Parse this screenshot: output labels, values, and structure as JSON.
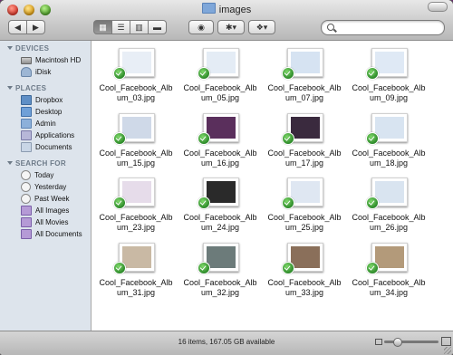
{
  "window": {
    "title": "images"
  },
  "toolbar": {
    "back_icon": "back-arrow-icon",
    "forward_icon": "forward-arrow-icon",
    "view_modes": [
      "icon-view",
      "list-view",
      "column-view",
      "coverflow-view"
    ],
    "quicklook_icon": "eye-icon",
    "action_icon": "gear-icon",
    "dropbox_icon": "dropbox-icon",
    "search_placeholder": ""
  },
  "sidebar": {
    "sections": [
      {
        "title": "DEVICES",
        "items": [
          {
            "label": "Macintosh HD",
            "icon": "harddrive-icon"
          },
          {
            "label": "iDisk",
            "icon": "idisk-icon"
          }
        ]
      },
      {
        "title": "PLACES",
        "items": [
          {
            "label": "Dropbox",
            "icon": "dropbox-icon"
          },
          {
            "label": "Desktop",
            "icon": "desktop-icon"
          },
          {
            "label": "Admin",
            "icon": "home-icon"
          },
          {
            "label": "Applications",
            "icon": "applications-icon"
          },
          {
            "label": "Documents",
            "icon": "documents-icon"
          }
        ]
      },
      {
        "title": "SEARCH FOR",
        "items": [
          {
            "label": "Today",
            "icon": "clock-icon"
          },
          {
            "label": "Yesterday",
            "icon": "clock-icon"
          },
          {
            "label": "Past Week",
            "icon": "clock-icon"
          },
          {
            "label": "All Images",
            "icon": "smart-folder-icon"
          },
          {
            "label": "All Movies",
            "icon": "smart-folder-icon"
          },
          {
            "label": "All Documents",
            "icon": "smart-folder-icon"
          }
        ]
      }
    ]
  },
  "files": [
    {
      "line1": "Cool_Facebook_Alb",
      "line2": "um_03.jpg",
      "tone": "#e8eef6"
    },
    {
      "line1": "Cool_Facebook_Alb",
      "line2": "um_05.jpg",
      "tone": "#e4ecf5"
    },
    {
      "line1": "Cool_Facebook_Alb",
      "line2": "um_07.jpg",
      "tone": "#d6e3f2"
    },
    {
      "line1": "Cool_Facebook_Alb",
      "line2": "um_09.jpg",
      "tone": "#dfe9f5"
    },
    {
      "line1": "Cool_Facebook_Alb",
      "line2": "um_15.jpg",
      "tone": "#cfd9e8"
    },
    {
      "line1": "Cool_Facebook_Alb",
      "line2": "um_16.jpg",
      "tone": "#5a2f5c"
    },
    {
      "line1": "Cool_Facebook_Alb",
      "line2": "um_17.jpg",
      "tone": "#3a2a3e"
    },
    {
      "line1": "Cool_Facebook_Alb",
      "line2": "um_18.jpg",
      "tone": "#d8e4f1"
    },
    {
      "line1": "Cool_Facebook_Alb",
      "line2": "um_23.jpg",
      "tone": "#e6dcea"
    },
    {
      "line1": "Cool_Facebook_Alb",
      "line2": "um_24.jpg",
      "tone": "#2a2a2a"
    },
    {
      "line1": "Cool_Facebook_Alb",
      "line2": "um_25.jpg",
      "tone": "#dfe7f2"
    },
    {
      "line1": "Cool_Facebook_Alb",
      "line2": "um_26.jpg",
      "tone": "#d9e4f0"
    },
    {
      "line1": "Cool_Facebook_Alb",
      "line2": "um_31.jpg",
      "tone": "#c9b9a4"
    },
    {
      "line1": "Cool_Facebook_Alb",
      "line2": "um_32.jpg",
      "tone": "#6c7b7a"
    },
    {
      "line1": "Cool_Facebook_Alb",
      "line2": "um_33.jpg",
      "tone": "#8a6f5a"
    },
    {
      "line1": "Cool_Facebook_Alb",
      "line2": "um_34.jpg",
      "tone": "#b39a7a"
    }
  ],
  "status": {
    "text": "16 items, 167.05 GB available"
  },
  "zoom": {
    "level": 0.2
  }
}
